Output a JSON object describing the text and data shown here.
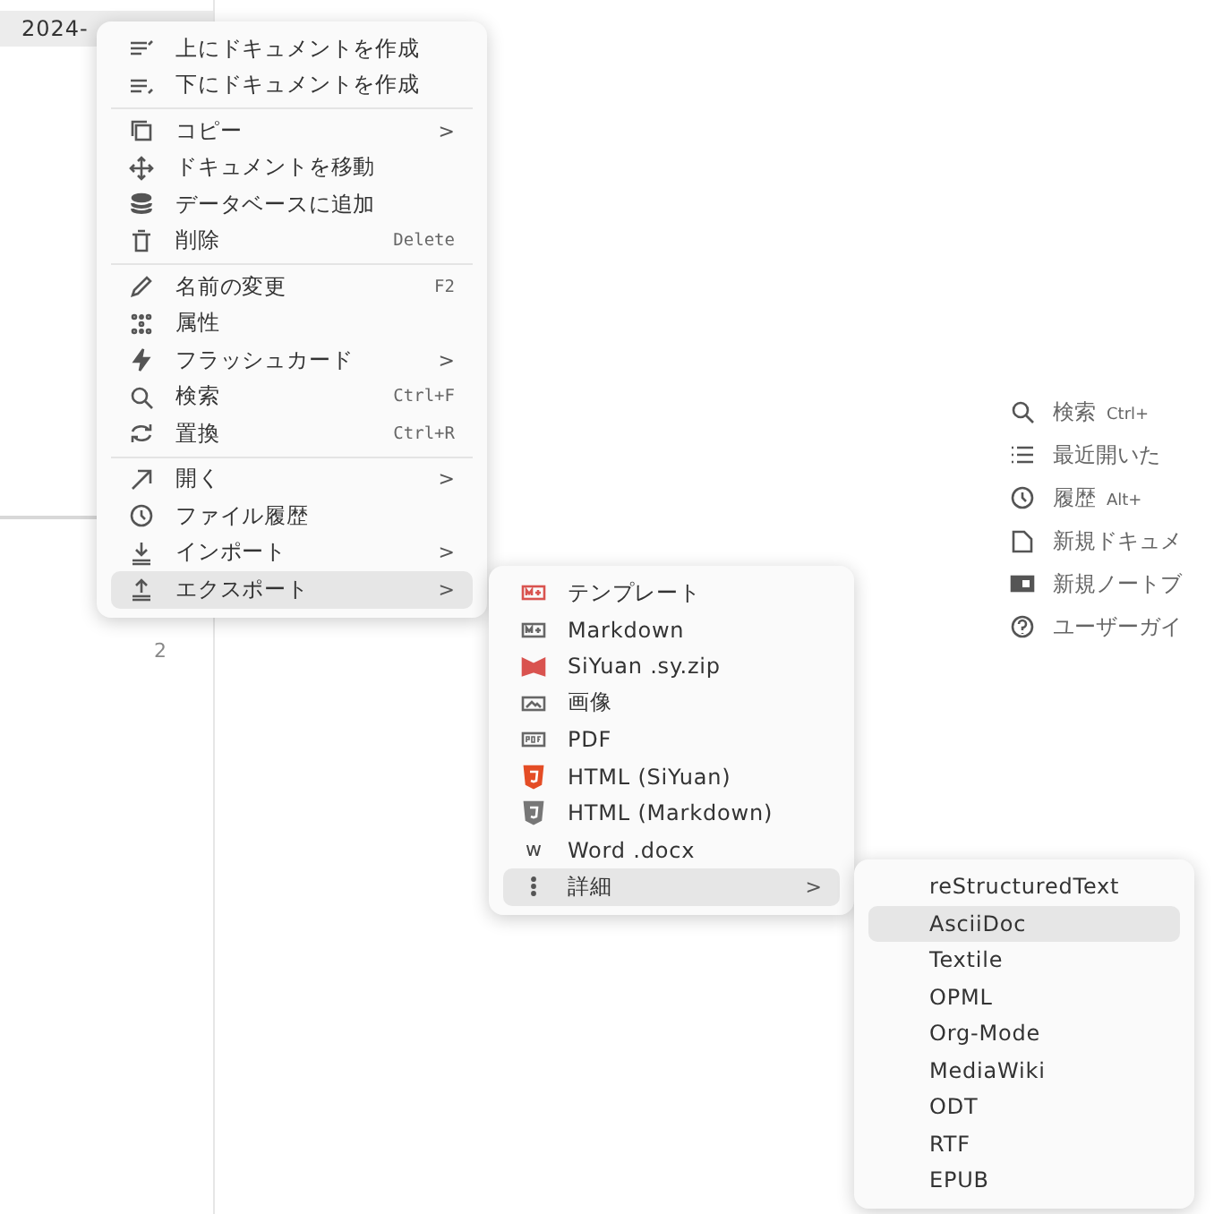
{
  "sidebar": {
    "doc_title": "2024-",
    "line_numbers": [
      "2"
    ]
  },
  "shortcuts": [
    {
      "label": "検索",
      "key": "Ctrl+"
    },
    {
      "label": "最近開いた"
    },
    {
      "label": "履歴",
      "key": "Alt+"
    },
    {
      "label": "新規ドキュメ"
    },
    {
      "label": "新規ノートブ"
    },
    {
      "label": "ユーザーガイ"
    }
  ],
  "context_menu": {
    "groups": [
      [
        {
          "label": "上にドキュメントを作成",
          "selected": false
        },
        {
          "label": "下にドキュメントを作成",
          "selected": false
        }
      ],
      [
        {
          "label": "コピー",
          "arrow": ">",
          "selected": false
        },
        {
          "label": "ドキュメントを移動",
          "selected": false
        },
        {
          "label": "データベースに追加",
          "selected": false
        },
        {
          "label": "削除",
          "shortcut": "Delete",
          "selected": false
        }
      ],
      [
        {
          "label": "名前の変更",
          "shortcut": "F2",
          "selected": false
        },
        {
          "label": "属性",
          "selected": false
        },
        {
          "label": "フラッシュカード",
          "arrow": ">",
          "selected": false
        },
        {
          "label": "検索",
          "shortcut": "Ctrl+F",
          "selected": false
        },
        {
          "label": "置換",
          "shortcut": "Ctrl+R",
          "selected": false
        }
      ],
      [
        {
          "label": "開く",
          "arrow": ">",
          "selected": false
        },
        {
          "label": "ファイル履歴",
          "selected": false
        },
        {
          "label": "インポート",
          "arrow": ">",
          "selected": false
        },
        {
          "label": "エクスポート",
          "arrow": ">",
          "selected": true
        }
      ]
    ]
  },
  "export_menu": {
    "items": [
      {
        "label": "テンプレート",
        "selected": false
      },
      {
        "label": "Markdown",
        "selected": false
      },
      {
        "label": "SiYuan .sy.zip",
        "selected": false
      },
      {
        "label": "画像",
        "selected": false
      },
      {
        "label": "PDF",
        "selected": false
      },
      {
        "label": "HTML (SiYuan)",
        "selected": false
      },
      {
        "label": "HTML (Markdown)",
        "selected": false
      },
      {
        "label": "Word .docx",
        "icon_text": "w",
        "selected": false
      },
      {
        "label": "詳細",
        "arrow": ">",
        "selected": true
      }
    ]
  },
  "more_menu": {
    "items": [
      {
        "label": "reStructuredText",
        "selected": false
      },
      {
        "label": "AsciiDoc",
        "selected": true
      },
      {
        "label": "Textile",
        "selected": false
      },
      {
        "label": "OPML",
        "selected": false
      },
      {
        "label": "Org-Mode",
        "selected": false
      },
      {
        "label": "MediaWiki",
        "selected": false
      },
      {
        "label": "ODT",
        "selected": false
      },
      {
        "label": "RTF",
        "selected": false
      },
      {
        "label": "EPUB",
        "selected": false
      }
    ]
  }
}
